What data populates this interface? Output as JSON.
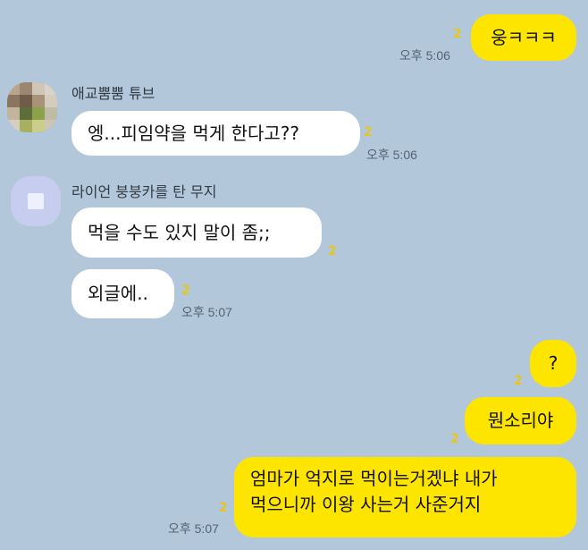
{
  "messages": [
    {
      "id": "m1",
      "sender": "me",
      "text": "웅ㅋㅋㅋ",
      "unread": "2",
      "time": "오후 5:06"
    },
    {
      "id": "m2",
      "sender_name": "애교뿜뿜 튜브",
      "text": "엥...피임약을 먹게 한다고??",
      "unread": "2",
      "time": "오후 5:06"
    },
    {
      "id": "m3",
      "sender_name": "라이언 붕붕카를 탄 무지",
      "text": "먹을 수도 있지 말이 좀;;",
      "unread": "2"
    },
    {
      "id": "m4",
      "text": "외글에..",
      "unread": "2",
      "time": "오후 5:07"
    },
    {
      "id": "m5",
      "sender": "me",
      "text": "?",
      "unread": "2"
    },
    {
      "id": "m6",
      "sender": "me",
      "text": "뭔소리야",
      "unread": "2"
    },
    {
      "id": "m7",
      "sender": "me",
      "line1": "엄마가 억지로 먹이는거겠냐 내가",
      "line2": "먹으니까 이왕 사는거 사준거지",
      "unread": "2",
      "time": "오후 5:07"
    }
  ],
  "colors": {
    "background": "#b2c7d9",
    "my_bubble": "#fee500",
    "other_bubble": "#ffffff",
    "unread_count": "#e7c61f"
  },
  "icons": {
    "avatar_1": "blurred-profile-photo",
    "avatar_2": "default-profile-square-icon"
  }
}
